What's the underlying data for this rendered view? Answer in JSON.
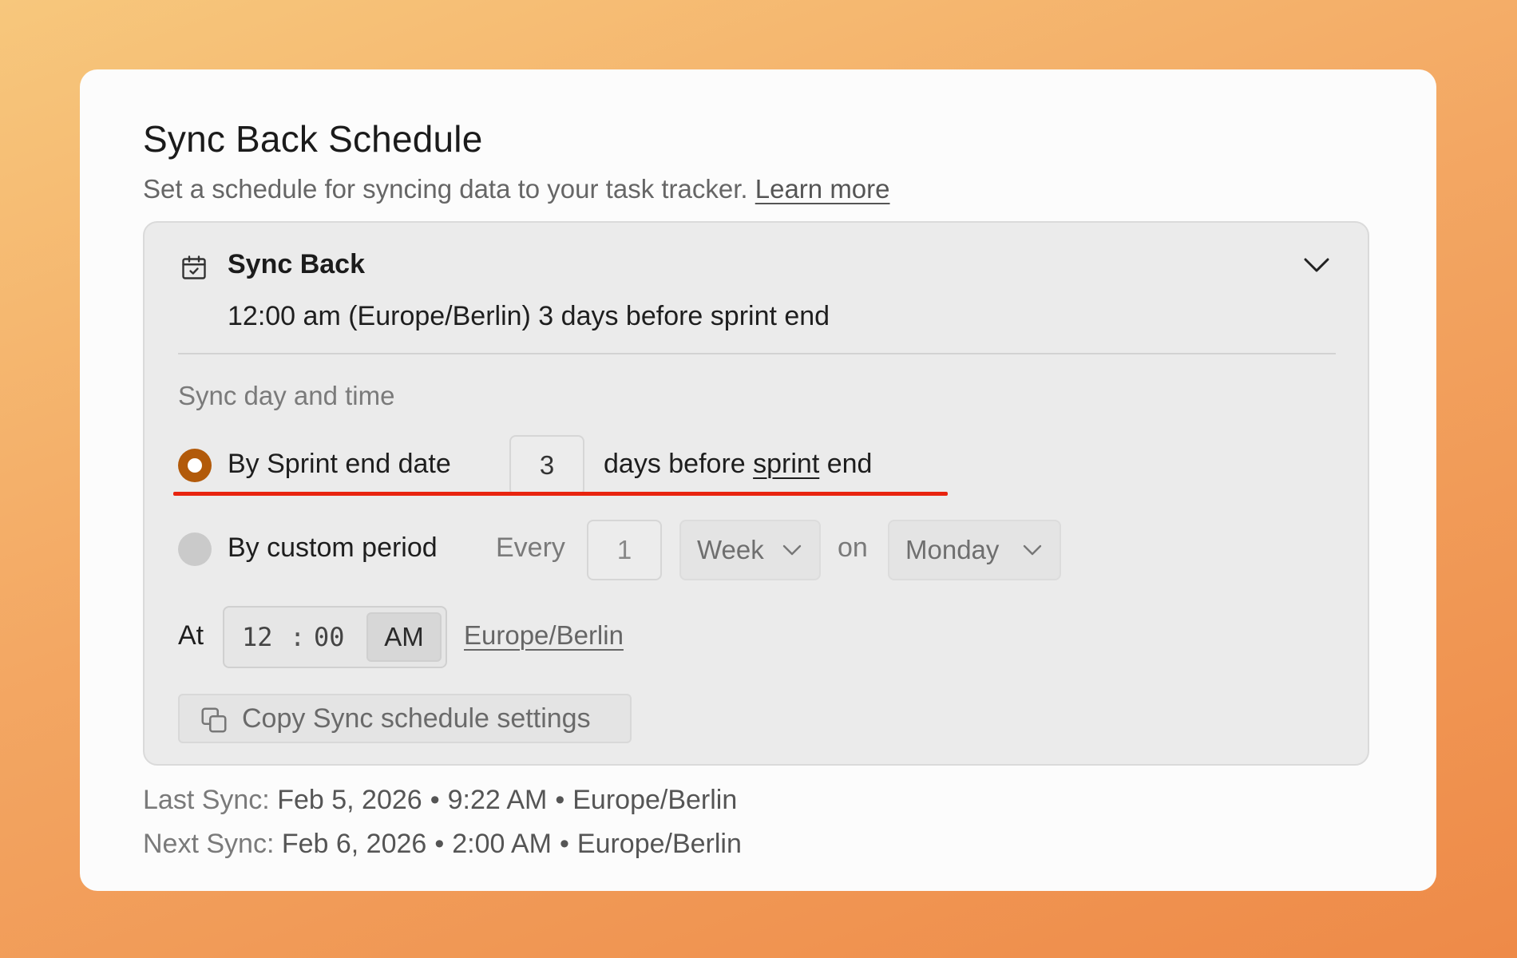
{
  "header": {
    "title": "Sync Back Schedule",
    "subtitle": "Set a schedule for syncing data to your task tracker.",
    "learn_more": "Learn more"
  },
  "panel": {
    "title": "Sync Back",
    "summary": "12:00 am (Europe/Berlin) 3 days before sprint end",
    "section_label": "Sync day and time",
    "option_sprint": {
      "label": "By Sprint end date",
      "days_value": "3",
      "suffix_pre": "days before",
      "suffix_link": "sprint",
      "suffix_post": "end",
      "selected": true
    },
    "option_custom": {
      "label": "By custom period",
      "every_label": "Every",
      "every_value": "1",
      "period_value": "Week",
      "on_label": "on",
      "day_value": "Monday",
      "selected": false
    },
    "time": {
      "at_label": "At",
      "hour": "12",
      "separator": ":",
      "minute": "00",
      "ampm": "AM",
      "timezone": "Europe/Berlin"
    },
    "copy_button": "Copy Sync schedule settings"
  },
  "footer": {
    "last_label": "Last Sync:",
    "last_date": "Feb 5, 2026",
    "last_time": "9:22 AM",
    "last_tz": "Europe/Berlin",
    "next_label": "Next Sync:",
    "next_date": "Feb 6, 2026",
    "next_time": "2:00 AM",
    "next_tz": "Europe/Berlin",
    "separator": "•"
  },
  "colors": {
    "accent": "#b25a0a",
    "highlight": "#e8240f"
  },
  "icons": {
    "calendar": "calendar-check-icon",
    "chevron": "chevron-down-icon",
    "copy": "copy-icon"
  }
}
